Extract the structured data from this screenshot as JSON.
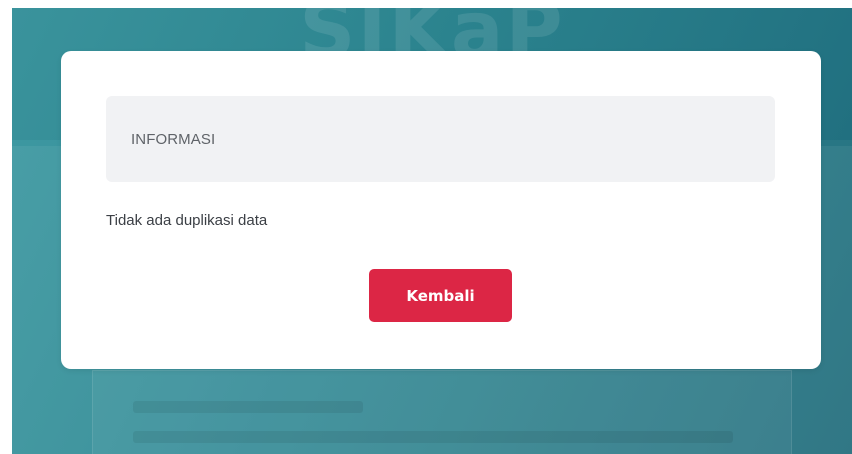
{
  "modal": {
    "title": "INFORMASI",
    "message": "Tidak ada duplikasi data",
    "back_button_label": "Kembali"
  },
  "colors": {
    "background_teal": "#2f8893",
    "button_red": "#dc2645",
    "header_gray": "#f1f2f4"
  }
}
